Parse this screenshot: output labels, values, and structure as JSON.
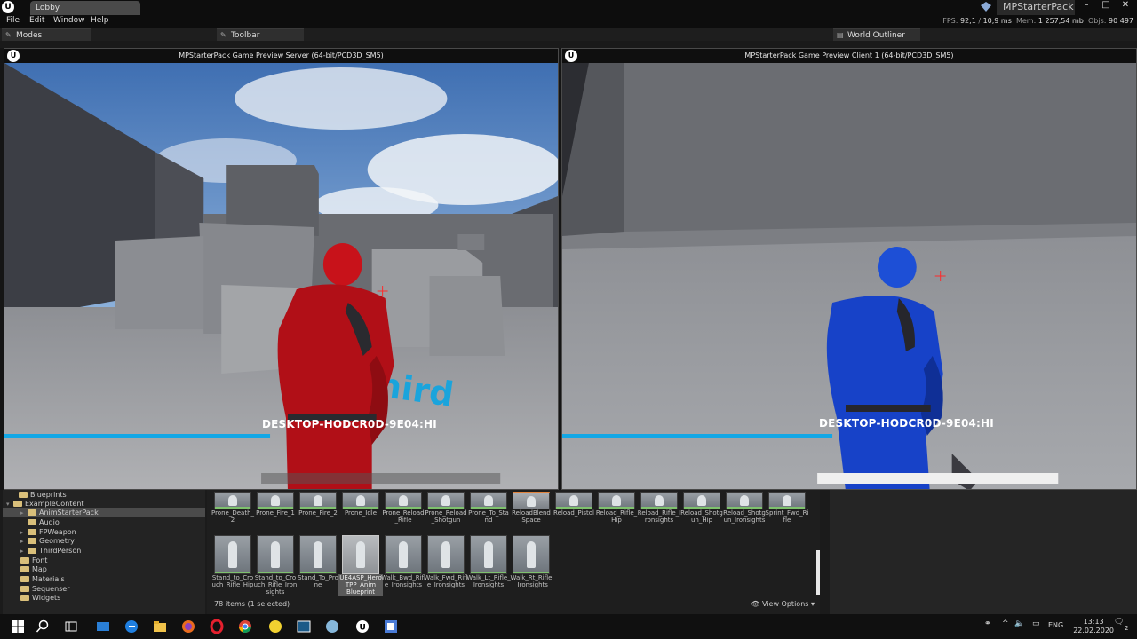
{
  "titlebar": {
    "level_tab": "Lobby",
    "project_name": "MPStarterPack",
    "window_buttons": [
      "–",
      "□",
      "✕"
    ]
  },
  "menubar": {
    "items": [
      "File",
      "Edit",
      "Window",
      "Help"
    ],
    "stats": {
      "fps_label": "FPS:",
      "fps": "92,1",
      "ms": "10,9 ms",
      "mem_label": "Mem:",
      "mem": "1 257,54 mb",
      "objs_label": "Objs:",
      "objs": "90 497"
    }
  },
  "tabs": {
    "modes": "Modes",
    "toolbar": "Toolbar",
    "world_outliner": "World Outliner"
  },
  "viewports": {
    "server": {
      "title": "MPStarterPack Game Preview Server (64-bit/PCD3D_SM5)",
      "player": "DESKTOP-HODCR0D-9E04:HI",
      "floor_text": "hird",
      "health_fill": 0.48
    },
    "client": {
      "title": "MPStarterPack Game Preview Client 1 (64-bit/PCD3D_SM5)",
      "player": "DESKTOP-HODCR0D-9E04:HI",
      "health_fill": 0.47
    }
  },
  "content_browser": {
    "tree": [
      {
        "label": "Blueprints",
        "indent": 2,
        "arrow": false,
        "selected": false
      },
      {
        "label": "ExampleContent",
        "indent": 1,
        "arrow": true,
        "selected": false
      },
      {
        "label": "AnimStarterPack",
        "indent": 2,
        "arrow": true,
        "selected": true
      },
      {
        "label": "Audio",
        "indent": 2,
        "arrow": false,
        "selected": false
      },
      {
        "label": "FPWeapon",
        "indent": 2,
        "arrow": true,
        "selected": false
      },
      {
        "label": "Geometry",
        "indent": 2,
        "arrow": true,
        "selected": false
      },
      {
        "label": "ThirdPerson",
        "indent": 2,
        "arrow": true,
        "selected": false
      },
      {
        "label": "Font",
        "indent": 1,
        "arrow": false,
        "selected": false
      },
      {
        "label": "Map",
        "indent": 1,
        "arrow": false,
        "selected": false
      },
      {
        "label": "Materials",
        "indent": 1,
        "arrow": false,
        "selected": false
      },
      {
        "label": "Sequenser",
        "indent": 1,
        "arrow": false,
        "selected": false
      },
      {
        "label": "Widgets",
        "indent": 1,
        "arrow": false,
        "selected": false
      }
    ],
    "assets_row1": [
      "Prone_Death_2",
      "Prone_Fire_1",
      "Prone_Fire_2",
      "Prone_Idle",
      "Prone_Reload_Rifle",
      "Prone_Reload_Shotgun",
      "Prone_To_Stand",
      "ReloadBlend Space",
      "Reload_Pistol",
      "Reload_Rifle_Hip",
      "Reload_Rifle_Ironsights",
      "Reload_Shotgun_Hip",
      "Reload_Shotgun_Ironsights",
      "Sprint_Fwd_Rifle"
    ],
    "assets_row2": [
      "Stand_to_Crouch_Rifle_Hip",
      "Stand_to_Crouch_Rifle_Ironsights",
      "Stand_To_Prone",
      "UE4ASP_Hero TPP_Anim Blueprint",
      "Walk_Bwd_Rifle_Ironsights",
      "Walk_Fwd_Rifle_Ironsights",
      "Walk_Lt_Rifle_Ironsights",
      "Walk_Rt_Rifle_Ironsights"
    ],
    "selected_asset": "UE4ASP_Hero TPP_Anim Blueprint",
    "item_count": "78 items (1 selected)",
    "view_options": "View Options"
  },
  "taskbar": {
    "lang": "ENG",
    "time": "13:13",
    "date": "22.02.2020",
    "notifications": "2"
  },
  "colors": {
    "health_bar": "#12a7e6",
    "red_player": "#c8121a",
    "blue_player": "#1742c8"
  }
}
